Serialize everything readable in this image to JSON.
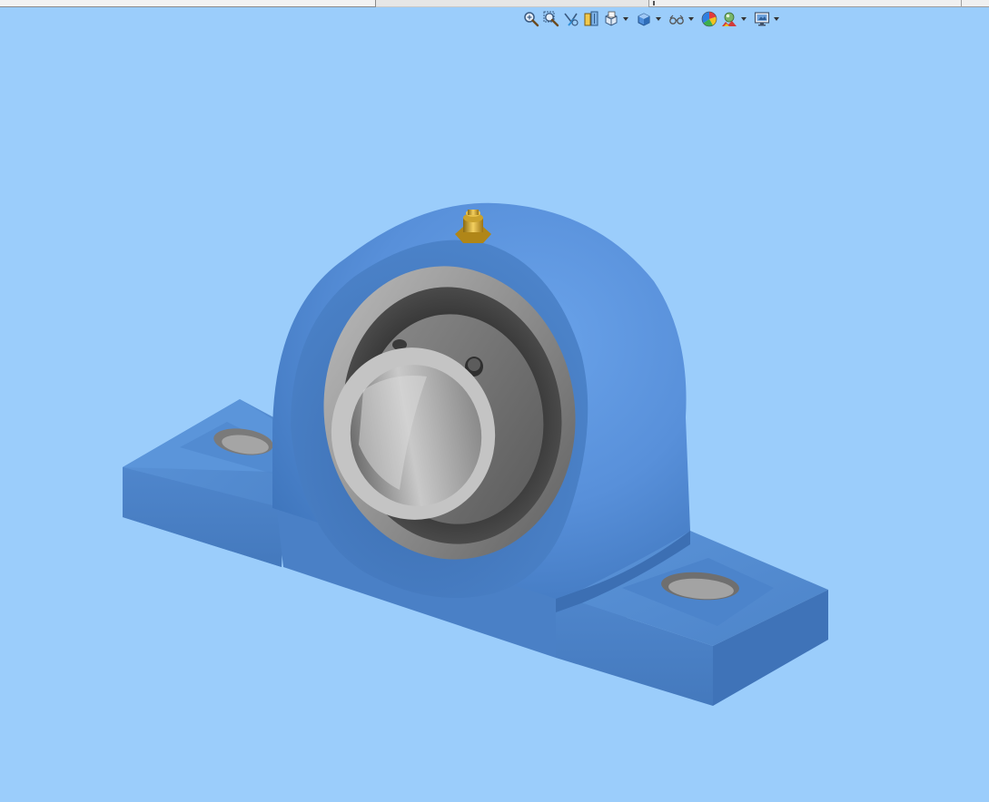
{
  "window": {
    "background_color": "#9bcdfb"
  },
  "hud_toolbar": {
    "items": [
      {
        "name": "zoom-to-fit",
        "icon": "zoom-to-fit-icon"
      },
      {
        "name": "zoom-to-area",
        "icon": "zoom-to-area-icon"
      },
      {
        "name": "previous-view",
        "icon": "previous-view-icon"
      },
      {
        "name": "section-view",
        "icon": "section-view-icon"
      },
      {
        "name": "view-orientation",
        "icon": "view-orientation-icon",
        "dropdown": true
      },
      {
        "name": "display-style",
        "icon": "display-style-icon",
        "dropdown": true
      },
      {
        "name": "hide-show-items",
        "icon": "hide-show-icon",
        "dropdown": true
      },
      {
        "name": "edit-appearance",
        "icon": "appearance-icon"
      },
      {
        "name": "apply-scene",
        "icon": "scene-icon",
        "dropdown": true
      },
      {
        "name": "view-settings",
        "icon": "view-settings-icon",
        "dropdown": true
      }
    ]
  },
  "model": {
    "description_visible": false,
    "housing_color": "#4f86cc",
    "bearing_color": "#9a9a9a",
    "grease_fitting_color": "#c9a227"
  }
}
